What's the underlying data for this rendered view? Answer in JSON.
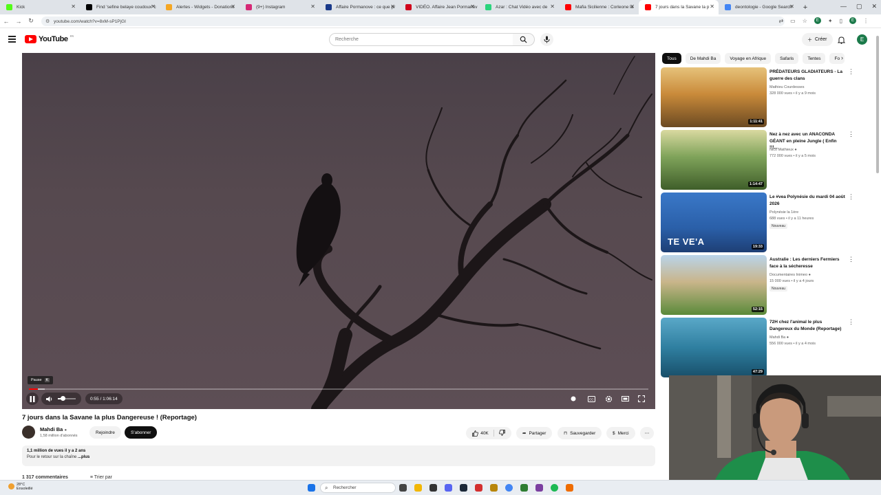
{
  "browser": {
    "tabs": [
      {
        "label": "Kick",
        "color": "#53fc18",
        "active": false
      },
      {
        "label": "Find 'sefine belaye coudoux' c",
        "color": "#000000",
        "active": false
      },
      {
        "label": "Alertes - Widgets - Donations",
        "color": "#f5a623",
        "active": false
      },
      {
        "label": "(9+) Instagram",
        "color": "#d62976",
        "active": false
      },
      {
        "label": "Affaire Pormanove : ce que pr",
        "color": "#1a3a8a",
        "active": false
      },
      {
        "label": "VIDÉO. Affaire Jean Pormanov",
        "color": "#d0021b",
        "active": false
      },
      {
        "label": "Azar : Chat Vidéo avec de",
        "color": "#2bd47d",
        "active": false
      },
      {
        "label": "Mafia Sicilienne : Corleone la",
        "color": "#ff0000",
        "active": false
      },
      {
        "label": "7 jours dans la Savane la p",
        "color": "#ff0000",
        "active": true
      },
      {
        "label": "deontologie - Google Search",
        "color": "#4285f4",
        "active": false
      }
    ],
    "url": "youtube.com/watch?v=8xM-sP1PjGI",
    "profile_initial": "E"
  },
  "header": {
    "logo_text": "YouTube",
    "logo_country": "FR",
    "search_placeholder": "Recherche",
    "create_label": "Créer",
    "avatar_initial": "E"
  },
  "player": {
    "pause_tooltip": "Pause",
    "pause_key": "K",
    "time": "0:55 / 1:06:14",
    "progress": 0.014,
    "buffered": 0.025,
    "volume": 0.25
  },
  "video": {
    "title": "7 jours dans la Savane la plus Dangereuse ! (Reportage)",
    "channel": "Mahdi Ba",
    "subscribers": "1,58 million d'abonnés",
    "join_label": "Rejoindre",
    "subscribe_label": "S'abonner",
    "likes": "40K",
    "share_label": "Partager",
    "save_label": "Sauvegarder",
    "thanks_label": "Merci",
    "description_stats": "1,1 million de vues il y a 2 ans",
    "description_text": "Pour le retour sur la chaîne",
    "description_more": "...plus",
    "comments_count": "1 317 commentaires",
    "sort_label": "Trier par"
  },
  "chips": [
    "Tous",
    "De Mahdi Ba",
    "Voyage en Afrique",
    "Safaris",
    "Tentes",
    "Fo"
  ],
  "recommendations": [
    {
      "title": "PRÉDATEURS GLADIATEURS - La guerre des clans",
      "channel": "Mathieu Courdesses",
      "verified": false,
      "meta": "328 000 vues • il y a 9 mois",
      "duration": "1:11:41",
      "badge": ""
    },
    {
      "title": "Nez à nez avec un ANACONDA GÉANT en pleine Jungle ( Enfin !!!...",
      "channel": "Nico Mathieux",
      "verified": true,
      "meta": "772 000 vues • il y a 5 mois",
      "duration": "1:14:47",
      "badge": ""
    },
    {
      "title": "Le #vea Polynésie du mardi 04 août 2026",
      "channel": "Polynésie la 1ère",
      "verified": false,
      "meta": "688 vues • il y a 11 heures",
      "duration": "19:33",
      "badge": "Nouveau",
      "overlay": "TE VE'A"
    },
    {
      "title": "Australie : Les derniers Fermiers face à la sécheresse",
      "channel": "Documentaires Inimeo",
      "verified": true,
      "meta": "15 000 vues • il y a 4 jours",
      "duration": "52:15",
      "badge": "Nouveau"
    },
    {
      "title": "72H chez l'animal le plus Dangereux du Monde (Reportage)",
      "channel": "Mahdi Ba",
      "verified": true,
      "meta": "556 000 vues • il y a 4 mois",
      "duration": "47:29",
      "badge": ""
    }
  ],
  "taskbar": {
    "weather_temp": "28°C",
    "weather_desc": "Ensoleillé",
    "search_label": "Rechercher"
  }
}
